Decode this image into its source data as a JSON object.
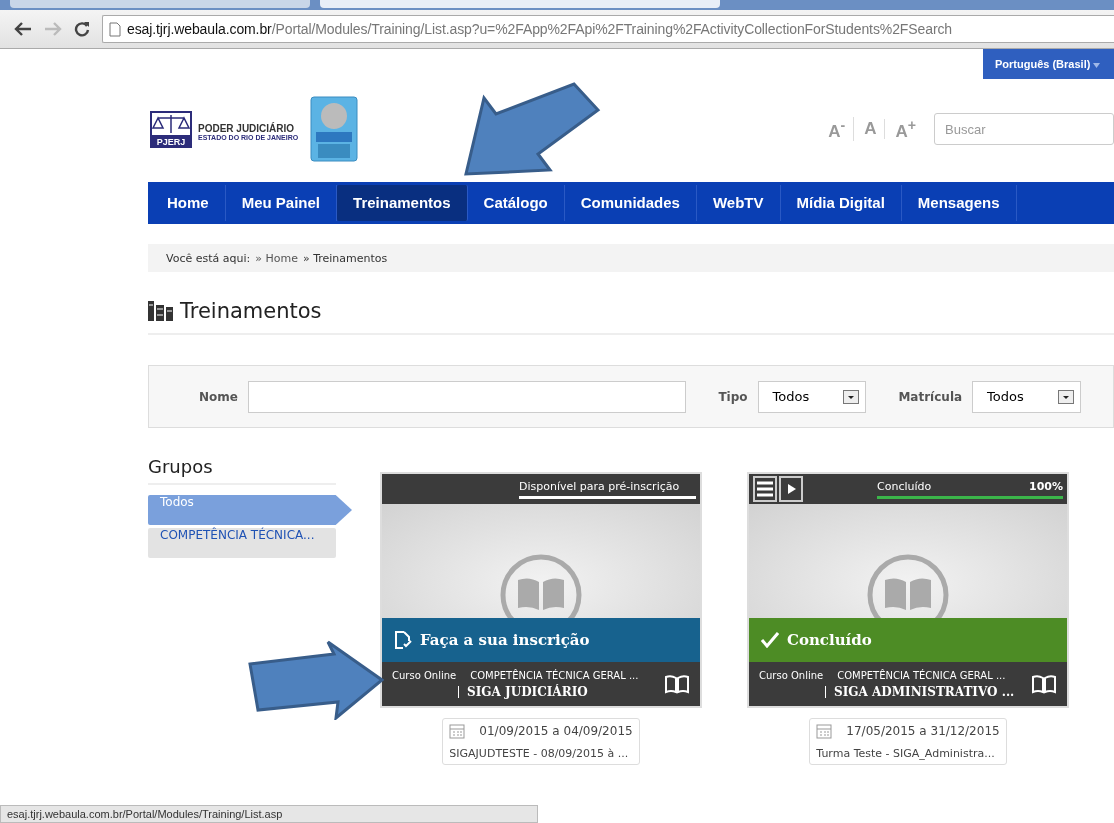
{
  "browser": {
    "url_host": "esaj.tjrj.webaula.com.br",
    "url_path": "/Portal/Modules/Training/List.asp?u=%2FApp%2FApi%2FTraining%2FActivityCollectionForStudents%2FSearch"
  },
  "language": "Português (Brasil)",
  "logo": {
    "short": "PJERJ",
    "title": "PODER JUDICIÁRIO",
    "subtitle": "ESTADO DO RIO DE JANEIRO"
  },
  "font_sizes": [
    "A$^{-}$",
    "A",
    "A$^{+}$"
  ],
  "search": {
    "placeholder": "Buscar"
  },
  "nav": [
    {
      "label": "Home",
      "selected": false
    },
    {
      "label": "Meu Painel",
      "selected": false
    },
    {
      "label": "Treinamentos",
      "selected": true
    },
    {
      "label": "Catálogo",
      "selected": false
    },
    {
      "label": "Comunidades",
      "selected": false
    },
    {
      "label": "WebTV",
      "selected": false
    },
    {
      "label": "Mídia Digital",
      "selected": false
    },
    {
      "label": "Mensagens",
      "selected": false
    }
  ],
  "breadcrumb": {
    "label": "Você está aqui:",
    "items": [
      "» Home",
      "» Treinamentos"
    ]
  },
  "page_title": "Treinamentos",
  "filters": {
    "name_label": "Nome",
    "type_label": "Tipo",
    "type_value": "Todos",
    "enrollment_label": "Matrícula",
    "enrollment_value": "Todos"
  },
  "groups": {
    "title": "Grupos",
    "items": [
      {
        "label": "Todos",
        "selected": true
      },
      {
        "label": "COMPETÊNCIA TÉCNICA...",
        "selected": false
      }
    ]
  },
  "cards": [
    {
      "kind": "enroll",
      "status": "Disponível para pré-inscrição",
      "banner": "Faça a sua inscrição",
      "type": "Curso Online",
      "category": "COMPETÊNCIA TÉCNICA GERAL ...",
      "title": "SIGA JUDICIÁRIO",
      "dates": "01/09/2015 a 04/09/2015",
      "class": "SIGAJUDTESTE - 08/09/2015 à ..."
    },
    {
      "kind": "completed",
      "status": "Concluído",
      "percent": "100%",
      "level": 1,
      "banner": "Concluído",
      "type": "Curso Online",
      "category": "COMPETÊNCIA TÉCNICA GERAL ...",
      "title": "SIGA ADMINISTRATIVO ...",
      "dates": "17/05/2015 a 31/12/2015",
      "class": "Turma Teste - SIGA_Administra..."
    }
  ],
  "status_bar": "esaj.tjrj.webaula.com.br/Portal/Modules/Training/List.asp"
}
